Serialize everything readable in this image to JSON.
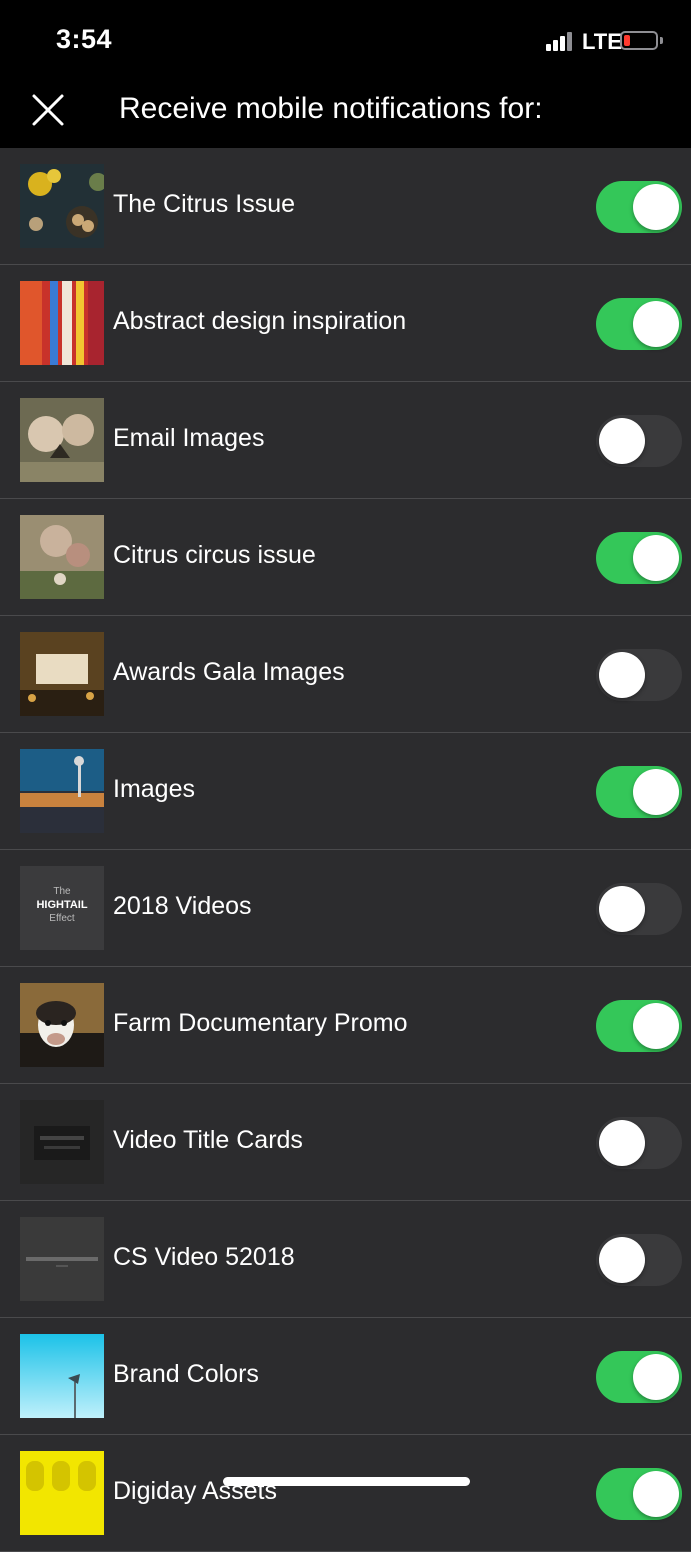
{
  "status": {
    "time": "3:54",
    "network": "LTE"
  },
  "header": {
    "title": "Receive mobile notifications for:"
  },
  "items": [
    {
      "label": "The Citrus Issue",
      "enabled": true
    },
    {
      "label": "Abstract design inspiration",
      "enabled": true
    },
    {
      "label": "Email Images",
      "enabled": false
    },
    {
      "label": "Citrus circus issue",
      "enabled": true
    },
    {
      "label": "Awards Gala Images",
      "enabled": false
    },
    {
      "label": "Images",
      "enabled": true
    },
    {
      "label": "2018 Videos",
      "enabled": false,
      "thumb_text": [
        "The",
        "HIGHTAIL",
        "Effect"
      ]
    },
    {
      "label": "Farm Documentary Promo",
      "enabled": true
    },
    {
      "label": "Video Title Cards",
      "enabled": false
    },
    {
      "label": "CS Video 52018",
      "enabled": false
    },
    {
      "label": "Brand Colors",
      "enabled": true
    },
    {
      "label": "Digiday Assets",
      "enabled": true
    }
  ],
  "colors": {
    "toggle_on": "#34c759",
    "toggle_off": "#3a3a3c",
    "background": "#2c2c2e"
  }
}
